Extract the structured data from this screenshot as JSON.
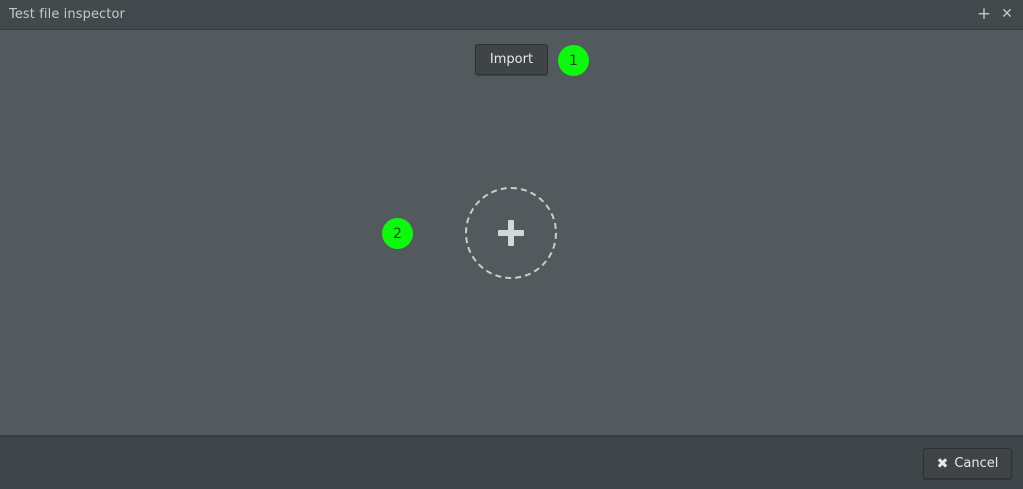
{
  "window": {
    "title": "Test file inspector",
    "add_icon": "+",
    "close_icon": "✕"
  },
  "main": {
    "import_label": "Import",
    "markers": [
      "1",
      "2"
    ],
    "add_icon": "plus-icon"
  },
  "footer": {
    "cancel_label": "Cancel",
    "cancel_icon": "✖"
  },
  "colors": {
    "marker": "#0ef70e",
    "background": "#525a5d",
    "titlebar": "#42494d"
  }
}
